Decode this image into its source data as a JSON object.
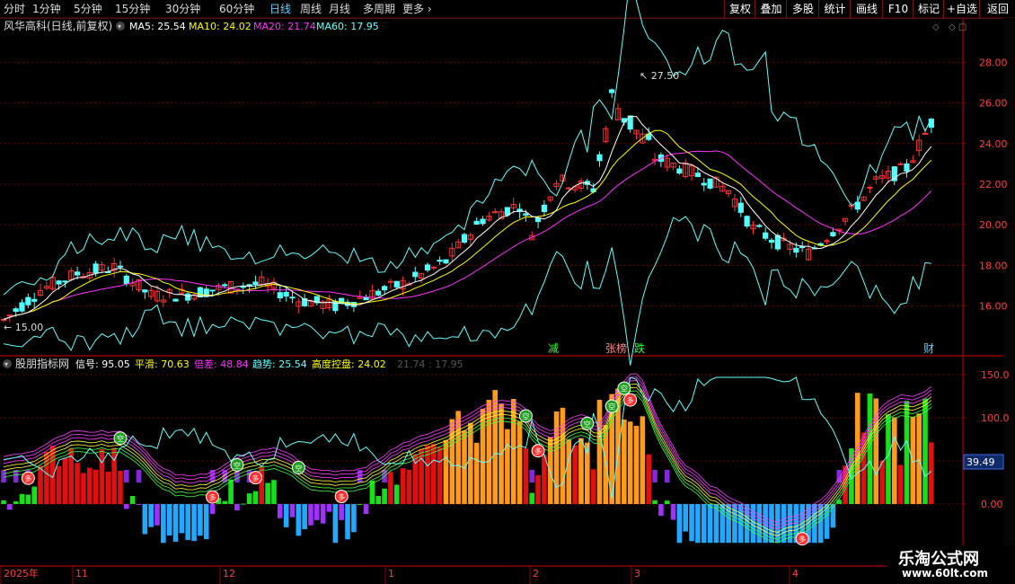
{
  "toolbar": {
    "periods": [
      "分时",
      "1分钟",
      "5分钟",
      "15分钟",
      "30分钟",
      "60分钟",
      "日线",
      "周线",
      "月线",
      "多周期",
      "更多"
    ],
    "active_period": "日线",
    "right_buttons": [
      "复权",
      "叠加",
      "多股",
      "统计",
      "画线",
      "F10",
      "标记",
      "+自选",
      "返回"
    ]
  },
  "main": {
    "stock_title": "风华高科(日线,前复权)",
    "ma": [
      {
        "label": "MA5: 25.54",
        "color": "#ffffff"
      },
      {
        "label": "MA10: 24.02",
        "color": "#ffff00"
      },
      {
        "label": "MA20: 21.74",
        "color": "#ff33ff"
      },
      {
        "label": "MA60: 17.95",
        "color": "#66ffff"
      }
    ],
    "y_ticks": [
      "28.00",
      "26.00",
      "24.00",
      "22.00",
      "20.00",
      "18.00",
      "16.00"
    ],
    "high_label": "27.50",
    "low_label": "15.00",
    "markers": [
      {
        "text": "减",
        "color": "#33ff33"
      },
      {
        "text": "张榜",
        "color": "#ff8888"
      },
      {
        "text": "跌",
        "color": "#33ff33"
      },
      {
        "text": "财",
        "color": "#66ccff"
      }
    ]
  },
  "indicator": {
    "name": "股朋指标网",
    "values": [
      {
        "label": "信号: 95.05",
        "color": "#ffffff"
      },
      {
        "label": "平滑: 70.63",
        "color": "#ffff00"
      },
      {
        "label": "倍差: 48.84",
        "color": "#ff33ff"
      },
      {
        "label": "趋势: 25.54",
        "color": "#66ffff"
      },
      {
        "label": "高度控盘: 24.02",
        "color": "#ffff00"
      },
      {
        "label": "21.74 : 17.95",
        "color": "#555555"
      }
    ],
    "y_ticks": [
      "150.0",
      "100.0",
      "50.0",
      "0.00"
    ],
    "current_value": "39.49",
    "buy_mark": "多",
    "sell_mark": "空"
  },
  "x_axis": {
    "labels": [
      "2025年",
      "11",
      "12",
      "1",
      "2",
      "3",
      "4"
    ]
  },
  "colors": {
    "up": "#ff3232",
    "down": "#54ffff",
    "grid": "#8b0000",
    "ma5": "#ffffff",
    "ma10": "#ffff00",
    "ma20": "#ff33ff",
    "ma60": "#66ffff"
  },
  "watermark": {
    "line1": "乐淘公式网",
    "line2": "www.60lt.com"
  }
}
